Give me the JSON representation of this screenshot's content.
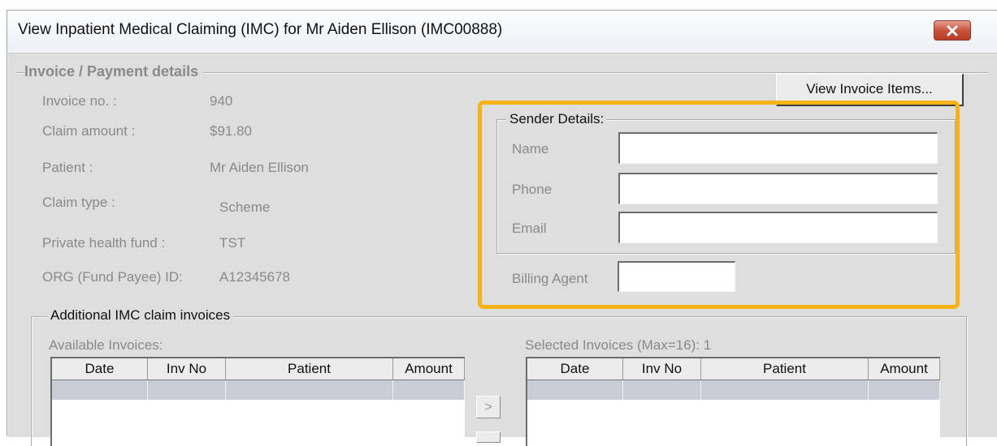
{
  "window": {
    "title": "View Inpatient Medical Claiming (IMC) for Mr Aiden Ellison (IMC00888)",
    "close_icon": "close-icon",
    "close_color": "#c8523c"
  },
  "invoice_section": {
    "title": "Invoice / Payment details",
    "fields": [
      {
        "label": "Invoice no. :",
        "value": "940"
      },
      {
        "label": "Claim amount :",
        "value": "$91.80"
      },
      {
        "label": "Patient :",
        "value": "Mr Aiden Ellison"
      },
      {
        "label": "Claim type :",
        "value": "Scheme"
      },
      {
        "label": "Private health fund :",
        "value": "TST"
      },
      {
        "label": "ORG (Fund Payee) ID:",
        "value": "A12345678"
      }
    ],
    "view_items_button": "View Invoice Items..."
  },
  "sender": {
    "title": "Sender Details:",
    "name_label": "Name",
    "name_value": "",
    "phone_label": "Phone",
    "phone_value": "",
    "email_label": "Email",
    "email_value": "",
    "billing_agent_label": "Billing Agent",
    "billing_agent_value": "",
    "highlight_color": "#f5b318"
  },
  "additional": {
    "title": "Additional IMC claim invoices",
    "available_label": "Available Invoices:",
    "selected_label": "Selected Invoices (Max=16): 1",
    "columns": [
      "Date",
      "Inv No",
      "Patient",
      "Amount"
    ],
    "move_right_label": ">"
  }
}
